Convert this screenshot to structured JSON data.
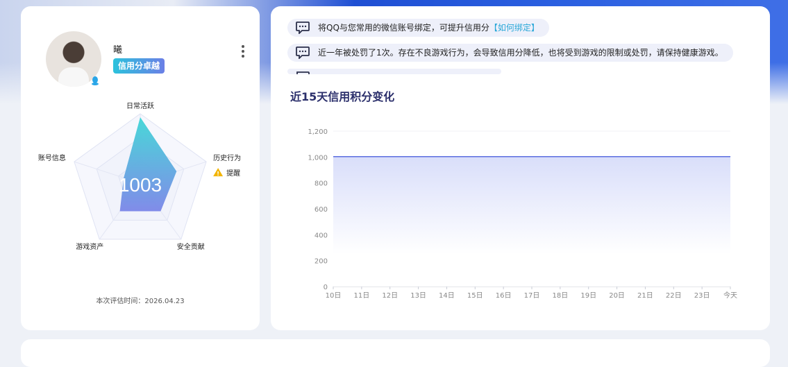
{
  "profile": {
    "nickname": "曦",
    "credit_level": "信用分卓越",
    "score": "1003",
    "eval_time_label": "本次评估时间：",
    "eval_time": "2026.04.23"
  },
  "radar": {
    "axes": [
      "日常活跃",
      "历史行为",
      "安全贡献",
      "游戏资产",
      "账号信息"
    ],
    "values": [
      0.95,
      0.55,
      0.5,
      0.5,
      0.25
    ],
    "warning_label": "提醒"
  },
  "notices": [
    {
      "text": "将QQ与您常用的微信账号绑定，可提升信用分",
      "link": "【如何绑定】"
    },
    {
      "text": "近一年被处罚了1次。存在不良游戏行为，会导致信用分降低，也将受到游戏的限制或处罚，请保持健康游戏。",
      "link": ""
    }
  ],
  "chart_title": "近15天信用积分变化",
  "chart_data": {
    "type": "area",
    "x": [
      "10日",
      "11日",
      "12日",
      "13日",
      "14日",
      "15日",
      "16日",
      "17日",
      "18日",
      "19日",
      "20日",
      "21日",
      "22日",
      "23日",
      "今天"
    ],
    "series": [
      {
        "values": [
          1003,
          1003,
          1003,
          1003,
          1003,
          1003,
          1003,
          1003,
          1003,
          1003,
          1003,
          1003,
          1003,
          1003,
          1003
        ]
      }
    ],
    "yticks": [
      "0",
      "200",
      "400",
      "600",
      "800",
      "1,000",
      "1,200"
    ],
    "ylim": [
      0,
      1200
    ],
    "color": "#5b6fe0"
  }
}
